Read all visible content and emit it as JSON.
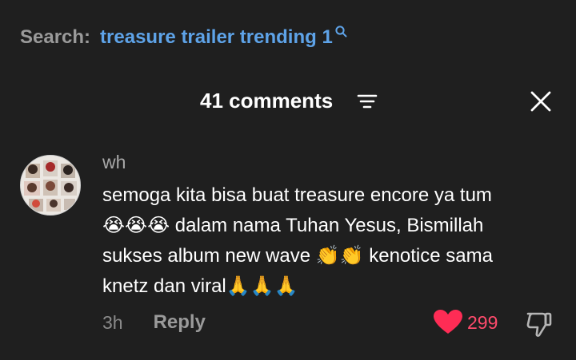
{
  "search": {
    "label": "Search:",
    "query": "treasure trailer trending 1"
  },
  "comments_panel": {
    "title": "41 comments"
  },
  "comment": {
    "username": "wh",
    "text_lines": [
      "semoga kita bisa buat treasure encore ya tum",
      "😭😭😭 dalam nama Tuhan Yesus, Bismillah",
      "sukses album new wave 👏👏 kenotice sama",
      "knetz dan viral🙏🙏🙏"
    ],
    "time": "3h",
    "reply_label": "Reply",
    "like_count": "299"
  },
  "colors": {
    "background": "#1f1f1f",
    "search_query": "#5ea3e8",
    "like": "#ff4b6c"
  },
  "icons": [
    "search-icon",
    "filter-icon",
    "close-icon",
    "heart-icon",
    "thumbs-down-icon"
  ]
}
